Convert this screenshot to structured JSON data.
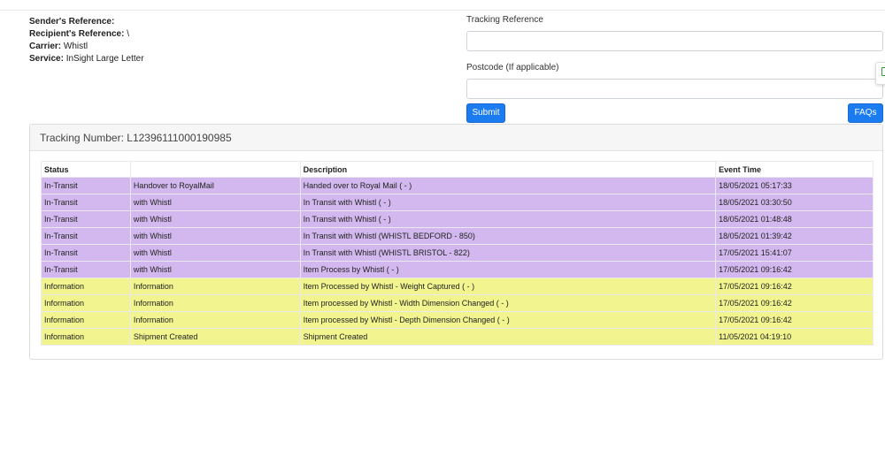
{
  "meta": {
    "senders_reference_label": "Sender's Reference:",
    "senders_reference_value": "",
    "recipients_reference_label": "Recipient's Reference:",
    "recipients_reference_value": "\\",
    "carrier_label": "Carrier:",
    "carrier_value": "Whistl",
    "service_label": "Service:",
    "service_value": "InSight Large Letter"
  },
  "form": {
    "tracking_reference_label": "Tracking Reference",
    "tracking_reference_value": "",
    "postcode_label": "Postcode (If applicable)",
    "postcode_value": "",
    "submit_label": "Submit",
    "faqs_label": "FAQs"
  },
  "card": {
    "tracking_number_label": "Tracking Number:",
    "tracking_number": "L12396111000190985"
  },
  "table": {
    "headers": [
      "Status",
      "",
      "Description",
      "Event Time"
    ],
    "rows": [
      {
        "type": "transit",
        "status": "In-Transit",
        "detail": "Handover to RoyalMail",
        "description": "Handed over to Royal Mail ( - )",
        "time": "18/05/2021 05:17:33"
      },
      {
        "type": "transit",
        "status": "In-Transit",
        "detail": "with Whistl",
        "description": "In Transit with Whistl ( - )",
        "time": "18/05/2021 03:30:50"
      },
      {
        "type": "transit",
        "status": "In-Transit",
        "detail": "with Whistl",
        "description": "In Transit with Whistl ( - )",
        "time": "18/05/2021 01:48:48"
      },
      {
        "type": "transit",
        "status": "In-Transit",
        "detail": "with Whistl",
        "description": "In Transit with Whistl (WHISTL BEDFORD - 850)",
        "time": "18/05/2021 01:39:42"
      },
      {
        "type": "transit",
        "status": "In-Transit",
        "detail": "with Whistl",
        "description": "In Transit with Whistl (WHISTL BRISTOL - 822)",
        "time": "17/05/2021 15:41:07"
      },
      {
        "type": "transit",
        "status": "In-Transit",
        "detail": "with Whistl",
        "description": "Item Process by Whistl ( - )",
        "time": "17/05/2021 09:16:42"
      },
      {
        "type": "info",
        "status": "Information",
        "detail": "Information",
        "description": "Item Processed by Whistl - Weight Captured ( - )",
        "time": "17/05/2021 09:16:42"
      },
      {
        "type": "info",
        "status": "Information",
        "detail": "Information",
        "description": "Item processed by Whistl - Width Dimension Changed ( - )",
        "time": "17/05/2021 09:16:42"
      },
      {
        "type": "info",
        "status": "Information",
        "detail": "Information",
        "description": "Item processed by Whistl - Depth Dimension Changed ( - )",
        "time": "17/05/2021 09:16:42"
      },
      {
        "type": "info",
        "status": "Information",
        "detail": "Shipment Created",
        "description": "Shipment Created",
        "time": "11/05/2021 04:19:10"
      }
    ]
  },
  "colors": {
    "transit_row": "#d2b8ee",
    "info_row": "#f2f58f",
    "button": "#1a7cf0"
  },
  "icons": {
    "side_widget": "feedback-icon"
  }
}
